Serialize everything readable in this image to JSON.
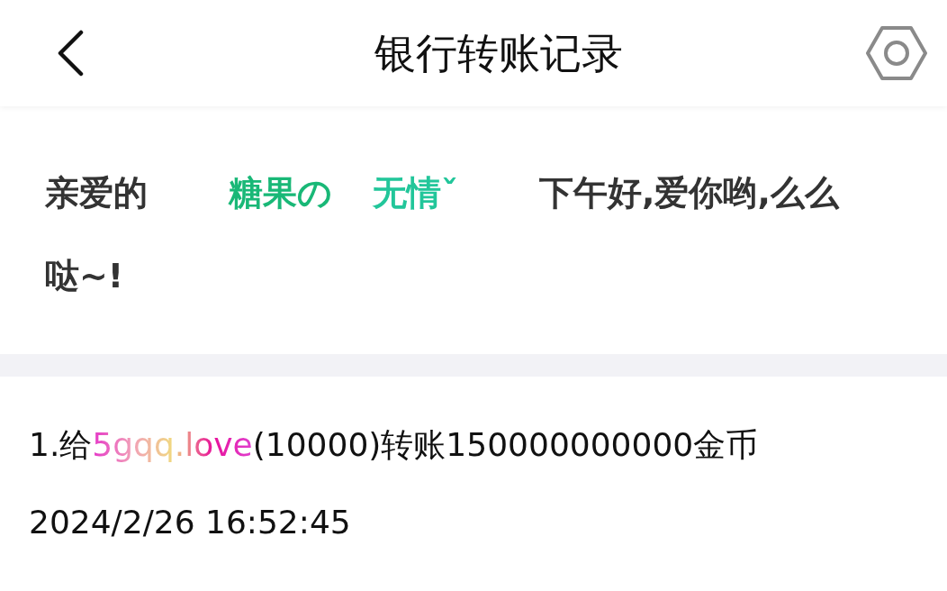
{
  "header": {
    "title": "银行转账记录"
  },
  "greeting": {
    "salutation": "亲爱的",
    "name_parts": [
      {
        "text": "糖果の",
        "color": "#19b877"
      },
      {
        "text": "无情ˇ",
        "color": "#22c69a"
      }
    ],
    "message": "下午好,爱你哟,么么哒~!"
  },
  "records": [
    {
      "prefix": "1.给",
      "recipient": "5gqq.love",
      "detail": "(10000)转账150000000000金币",
      "time": "2024/2/26 16:52:45"
    }
  ]
}
